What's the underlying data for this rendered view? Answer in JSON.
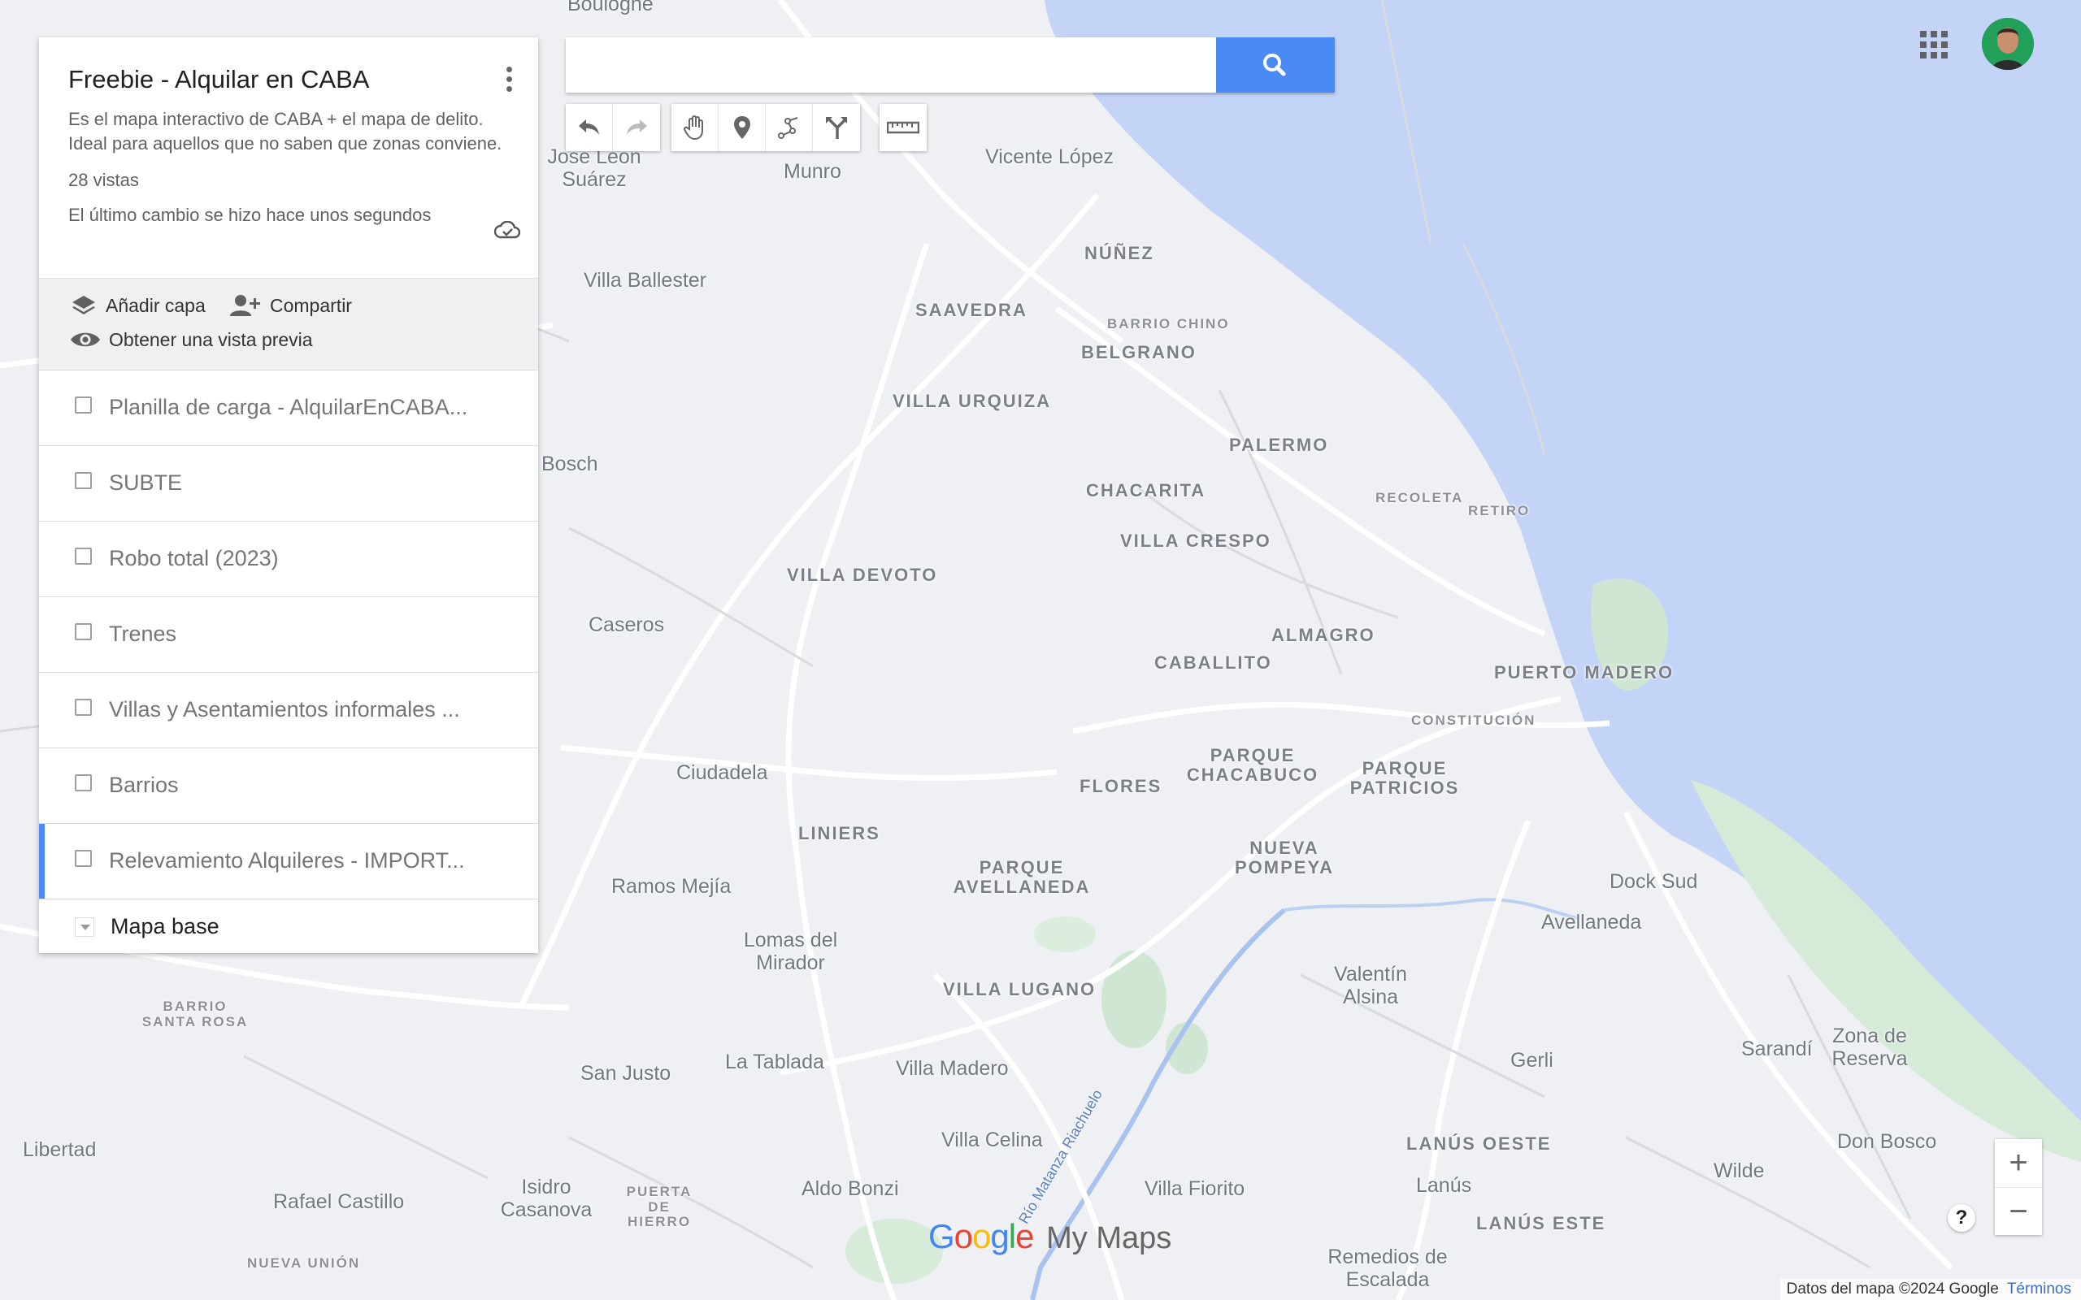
{
  "panel": {
    "title": "Freebie - Alquilar en CABA",
    "description": "Es el mapa interactivo de CABA + el mapa de delito. Ideal para aquellos que no saben que zonas conviene.",
    "views": "28 vistas",
    "saved_status": "El último cambio se hizo hace unos segundos",
    "actions": {
      "add_layer": "Añadir capa",
      "share": "Compartir",
      "preview": "Obtener una vista previa"
    },
    "layers": [
      {
        "label": "Planilla de carga - AlquilarEnCABA...",
        "checked": false
      },
      {
        "label": "SUBTE",
        "checked": false
      },
      {
        "label": "Robo total (2023)",
        "checked": false
      },
      {
        "label": "Trenes",
        "checked": false
      },
      {
        "label": "Villas y Asentamientos informales ...",
        "checked": false
      },
      {
        "label": "Barrios",
        "checked": false
      },
      {
        "label": "Relevamiento Alquileres - IMPORT...",
        "checked": false,
        "selected": true
      }
    ],
    "basemap_label": "Mapa base"
  },
  "search": {
    "value": "",
    "placeholder": ""
  },
  "toolbar": [
    "undo-icon",
    "redo-icon",
    "hand-icon",
    "marker-icon",
    "draw-line-icon",
    "directions-icon",
    "ruler-icon"
  ],
  "map": {
    "labels": [
      {
        "text": "Boulogne"
      },
      {
        "text": "Vicente López"
      },
      {
        "text": "Munro"
      },
      {
        "text": "José León Suárez"
      },
      {
        "text": "NÚÑEZ"
      },
      {
        "text": "Villa Ballester"
      },
      {
        "text": "SAAVEDRA"
      },
      {
        "text": "BARRIO CHINO"
      },
      {
        "text": "BELGRANO"
      },
      {
        "text": "VILLA URQUIZA"
      },
      {
        "text": "PALERMO"
      },
      {
        "text": "Bosch"
      },
      {
        "text": "CHACARITA"
      },
      {
        "text": "RECOLETA"
      },
      {
        "text": "RETIRO"
      },
      {
        "text": "VILLA CRESPO"
      },
      {
        "text": "VILLA DEVOTO"
      },
      {
        "text": "Caseros"
      },
      {
        "text": "ALMAGRO"
      },
      {
        "text": "CABALLITO"
      },
      {
        "text": "PUERTO MADERO"
      },
      {
        "text": "CONSTITUCIÓN"
      },
      {
        "text": "Ciudadela"
      },
      {
        "text": "PARQUE CHACABUCO"
      },
      {
        "text": "PARQUE PATRICIOS"
      },
      {
        "text": "FLORES"
      },
      {
        "text": "LINIERS"
      },
      {
        "text": "NUEVA POMPEYA"
      },
      {
        "text": "PARQUE AVELLANEDA"
      },
      {
        "text": "Ramos Mejía"
      },
      {
        "text": "Dock Sud"
      },
      {
        "text": "Avellaneda"
      },
      {
        "text": "Lomas del Mirador"
      },
      {
        "text": "VILLA LUGANO"
      },
      {
        "text": "Valentín Alsina"
      },
      {
        "text": "BARRIO SANTA ROSA"
      },
      {
        "text": "Zona de Reserva"
      },
      {
        "text": "Sarandí"
      },
      {
        "text": "La Tablada"
      },
      {
        "text": "San Justo"
      },
      {
        "text": "Villa Madero"
      },
      {
        "text": "Gerli"
      },
      {
        "text": "Libertad"
      },
      {
        "text": "Villa Celina"
      },
      {
        "text": "LANÚS OESTE"
      },
      {
        "text": "Don Bosco"
      },
      {
        "text": "Wilde"
      },
      {
        "text": "Rafael Castillo"
      },
      {
        "text": "Isidro Casanova"
      },
      {
        "text": "PUERTA DE HIERRO"
      },
      {
        "text": "Aldo Bonzi"
      },
      {
        "text": "Villa Fiorito"
      },
      {
        "text": "Lanús"
      },
      {
        "text": "LANÚS ESTE"
      },
      {
        "text": "NUEVA UNIÓN"
      },
      {
        "text": "Remedios de Escalada"
      },
      {
        "text": "Río Matanza Riachuelo"
      },
      {
        "text": "Villa Ballester"
      }
    ]
  },
  "logo": {
    "google": "Google",
    "product": "My Maps"
  },
  "footer": {
    "data": "Datos del mapa ©2024 Google",
    "terms": "Términos"
  },
  "zoom": {
    "in": "+",
    "out": "−"
  },
  "help": "?",
  "colors": {
    "water": "#c3d4f7",
    "land": "#eef0f3",
    "park": "#cfe7d2",
    "accent": "#4a8af4"
  }
}
